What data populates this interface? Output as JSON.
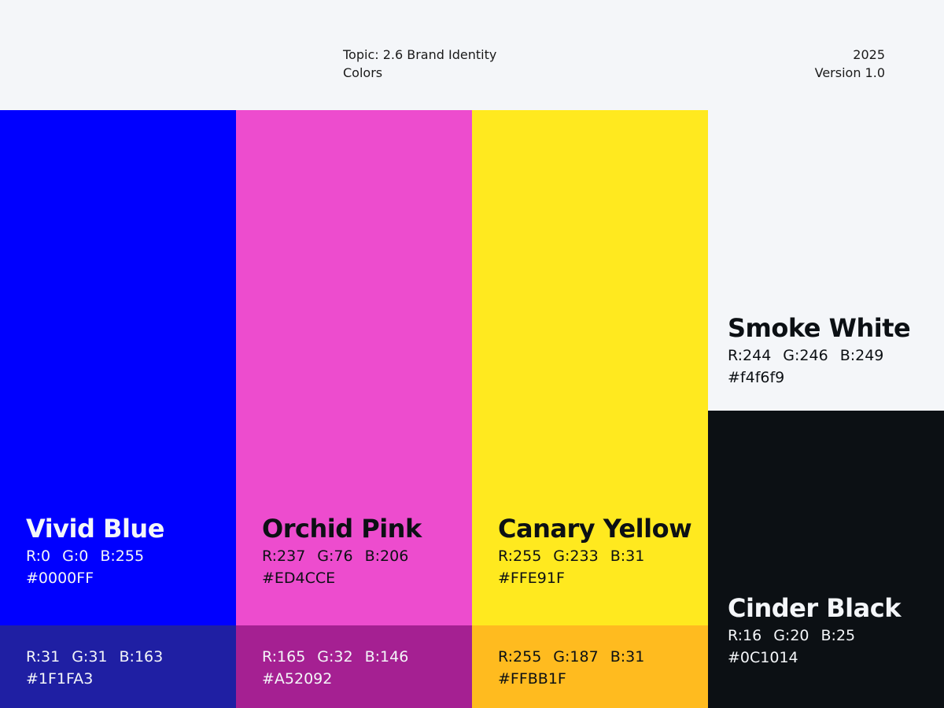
{
  "header": {
    "topic_line1": "Topic: 2.6 Brand Identity",
    "topic_line2": "Colors",
    "year": "2025",
    "version": "Version 1.0"
  },
  "colors": {
    "vivid_blue": {
      "name": "Vivid Blue",
      "r": "R:0",
      "g": "G:0",
      "b": "B:255",
      "hex": "#0000FF",
      "color": "#0000FF"
    },
    "vivid_blue_shade": {
      "r": "R:31",
      "g": "G:31",
      "b": "B:163",
      "hex": "#1F1FA3",
      "color": "#1F1FA3"
    },
    "orchid_pink": {
      "name": "Orchid Pink",
      "r": "R:237",
      "g": "G:76",
      "b": "B:206",
      "hex": "#ED4CCE",
      "color": "#ED4CCE"
    },
    "orchid_pink_shade": {
      "r": "R:165",
      "g": "G:32",
      "b": "B:146",
      "hex": "#A52092",
      "color": "#A52092"
    },
    "canary_yellow": {
      "name": "Canary Yellow",
      "r": "R:255",
      "g": "G:233",
      "b": "B:31",
      "hex": "#FFE91F",
      "color": "#FFE91F"
    },
    "canary_yellow_shade": {
      "r": "R:255",
      "g": "G:187",
      "b": "B:31",
      "hex": "#FFBB1F",
      "color": "#FFBB1F"
    },
    "smoke_white": {
      "name": "Smoke White",
      "r": "R:244",
      "g": "G:246",
      "b": "B:249",
      "hex": "#f4f6f9",
      "color": "#f4f6f9"
    },
    "cinder_black": {
      "name": "Cinder Black",
      "r": "R:16",
      "g": "G:20",
      "b": "B:25",
      "hex": "#0C1014",
      "color": "#0C1014"
    }
  }
}
